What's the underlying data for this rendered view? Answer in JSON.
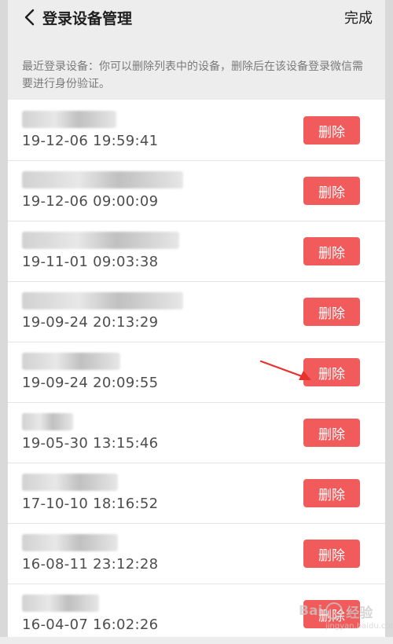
{
  "header": {
    "title": "登录设备管理",
    "done_label": "完成",
    "back_icon": "chevron-left-icon"
  },
  "description": "最近登录设备：你可以删除列表中的设备，删除后在该设备登录微信需要进行身份验证。",
  "devices": [
    {
      "time": "19-12-06 19:59:41",
      "delete_label": "删除"
    },
    {
      "time": "19-12-06 09:00:09",
      "delete_label": "删除"
    },
    {
      "time": "19-11-01 09:03:38",
      "delete_label": "删除"
    },
    {
      "time": "19-09-24 20:13:29",
      "delete_label": "删除"
    },
    {
      "time": "19-09-24 20:09:55",
      "delete_label": "删除"
    },
    {
      "time": "19-05-30 13:15:46",
      "delete_label": "删除"
    },
    {
      "time": "17-10-10 18:16:52",
      "delete_label": "删除"
    },
    {
      "time": "16-08-11 23:12:28",
      "delete_label": "删除"
    },
    {
      "time": "16-04-07 16:02:26",
      "delete_label": "删除"
    }
  ],
  "watermark": {
    "text_left": "Bai",
    "text_right": "经验",
    "sub": "jingyan.baidu.com"
  },
  "colors": {
    "delete_button": "#f15b5b",
    "annotation_arrow": "#e8322d",
    "page_background": "#ededed"
  }
}
